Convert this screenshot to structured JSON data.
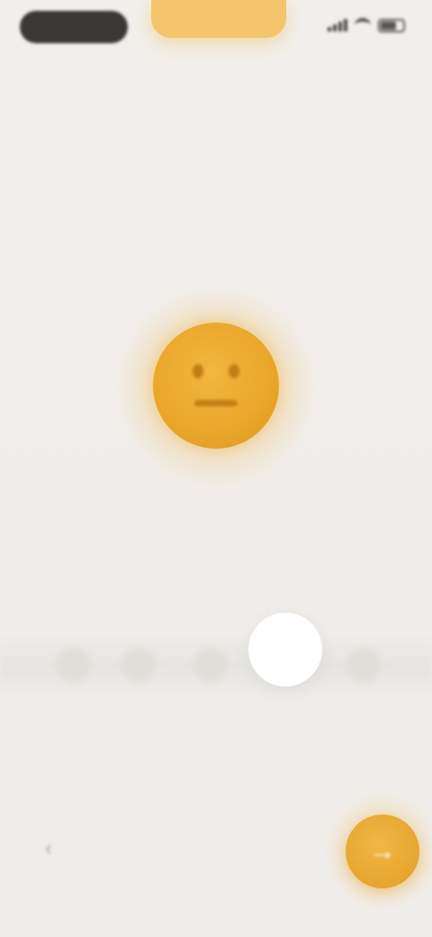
{
  "status_bar": {
    "time": "",
    "signal_icon": "signal-bars-icon",
    "wifi_icon": "wifi-icon",
    "battery_icon": "battery-icon"
  },
  "prompt": {
    "text": ""
  },
  "mood": {
    "selected_label": "",
    "face_icon": "neutral-face-icon",
    "face_color": "#e9a62a",
    "options_count_visible": 5,
    "selected_index": 3
  },
  "controls": {
    "back_icon": "back-arrow-icon",
    "back_glyph": "‹",
    "next_icon": "forward-arrow-icon",
    "next_glyph": "→",
    "accent_color": "#e6a62f"
  },
  "colors": {
    "background": "#f0eeeb",
    "accent": "#f4c56a"
  }
}
